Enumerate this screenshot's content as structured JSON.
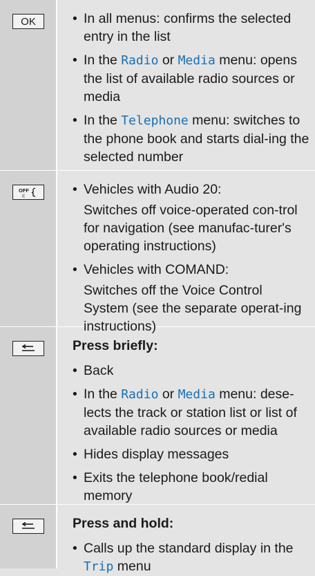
{
  "rows": [
    {
      "key": "OK",
      "items": [
        {
          "text": "In all menus: confirms the selected entry in the list"
        },
        {
          "pre": "In the ",
          "menu1": "Radio",
          "mid": " or ",
          "menu2": "Media",
          "post": " menu: opens the list of available radio sources or media"
        },
        {
          "pre": "In the ",
          "menu1": "Telephone",
          "post": " menu: switches to the phone book and starts dial-ing the selected number"
        }
      ]
    },
    {
      "key": "OFF",
      "items": [
        {
          "text": "Vehicles with Audio 20:",
          "sub": "Switches off voice-operated con-trol for navigation (see manufac-turer's operating instructions)"
        },
        {
          "text": "Vehicles with COMAND:",
          "sub": "Switches off the Voice Control System (see the separate operat-ing instructions)"
        }
      ]
    },
    {
      "heading": "Press briefly:",
      "items": [
        {
          "text": "Back"
        },
        {
          "pre": "In the ",
          "menu1": "Radio",
          "mid": " or ",
          "menu2": "Media",
          "post": " menu: dese-lects the track or station list or list of available radio sources or media"
        },
        {
          "text": "Hides display messages"
        },
        {
          "text": "Exits the telephone book/redial memory"
        }
      ]
    },
    {
      "heading": "Press and hold:",
      "items": [
        {
          "pre": "Calls up the standard display in the ",
          "menu1": "Trip",
          "post": " menu"
        }
      ]
    }
  ]
}
